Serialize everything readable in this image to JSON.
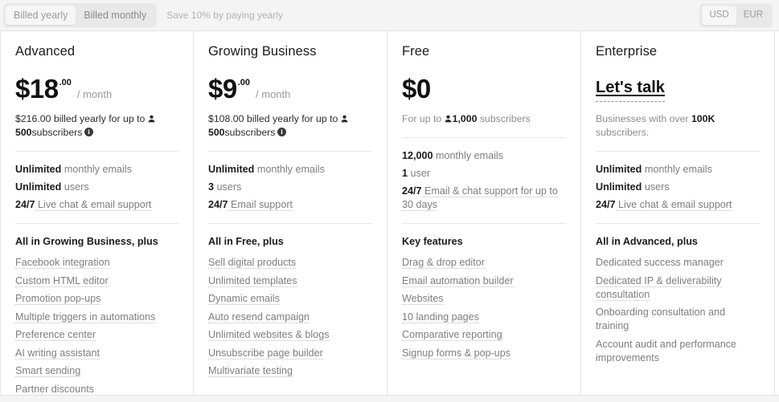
{
  "billing_toggle": {
    "options": [
      {
        "label": "Billed yearly",
        "active": true
      },
      {
        "label": "Billed monthly",
        "active": false
      }
    ],
    "save_note": "Save 10% by paying yearly"
  },
  "currency_toggle": {
    "options": [
      {
        "label": "USD",
        "active": true
      },
      {
        "label": "EUR",
        "active": false
      }
    ]
  },
  "icons": {
    "person": "person-icon",
    "info": "info-icon"
  },
  "plans": [
    {
      "name": "Advanced",
      "price_amount": "$18",
      "price_cents": ".00",
      "price_period": "/ month",
      "billing_note_prefix": "$216.00 billed yearly for up to ",
      "billing_note_count": "500",
      "billing_note_suffix": "subscribers",
      "has_info_icon": true,
      "specs": [
        {
          "bold": "Unlimited",
          "rest": " monthly emails",
          "dotted": false
        },
        {
          "bold": "Unlimited",
          "rest": " users",
          "dotted": false
        },
        {
          "bold": "24/7",
          "rest": " Live chat & email support",
          "dotted": true
        }
      ],
      "group_title": "All in Growing Business, plus",
      "features": [
        {
          "label": "Facebook integration",
          "dotted": true
        },
        {
          "label": "Custom HTML editor",
          "dotted": true
        },
        {
          "label": "Promotion pop-ups",
          "dotted": true
        },
        {
          "label": "Multiple triggers in automations",
          "dotted": true
        },
        {
          "label": "Preference center",
          "dotted": true
        },
        {
          "label": "AI writing assistant",
          "dotted": true
        },
        {
          "label": "Smart sending",
          "dotted": true
        },
        {
          "label": "Partner discounts",
          "dotted": true
        }
      ]
    },
    {
      "name": "Growing Business",
      "price_amount": "$9",
      "price_cents": ".00",
      "price_period": "/ month",
      "billing_note_prefix": "$108.00 billed yearly for up to ",
      "billing_note_count": "500",
      "billing_note_suffix": "subscribers",
      "has_info_icon": true,
      "specs": [
        {
          "bold": "Unlimited",
          "rest": " monthly emails",
          "dotted": false
        },
        {
          "bold": "3",
          "rest": " users",
          "dotted": false
        },
        {
          "bold": "24/7",
          "rest": " Email support",
          "dotted": true
        }
      ],
      "group_title": "All in Free, plus",
      "features": [
        {
          "label": "Sell digital products",
          "dotted": true
        },
        {
          "label": "Unlimited templates",
          "dotted": true
        },
        {
          "label": "Dynamic emails",
          "dotted": true
        },
        {
          "label": "Auto resend campaign",
          "dotted": true
        },
        {
          "label": "Unlimited websites & blogs",
          "dotted": true
        },
        {
          "label": "Unsubscribe page builder",
          "dotted": true
        },
        {
          "label": "Multivariate testing",
          "dotted": true
        }
      ]
    },
    {
      "name": "Free",
      "price_amount": "$0",
      "price_cents": "",
      "price_period": "",
      "billing_note_prefix": "For up to ",
      "billing_note_count": "1,000",
      "billing_note_suffix": " subscribers",
      "has_info_icon": false,
      "specs": [
        {
          "bold": "12,000",
          "rest": " monthly emails",
          "dotted": false
        },
        {
          "bold": "1",
          "rest": " user",
          "dotted": false
        },
        {
          "bold": "24/7",
          "rest": " Email & chat support for up to 30 days",
          "dotted": true
        }
      ],
      "group_title": "Key features",
      "features": [
        {
          "label": "Drag & drop editor",
          "dotted": true
        },
        {
          "label": "Email automation builder",
          "dotted": true
        },
        {
          "label": "Websites",
          "dotted": true
        },
        {
          "label": "10 landing pages",
          "dotted": true
        },
        {
          "label": "Comparative reporting",
          "dotted": true
        },
        {
          "label": "Signup forms & pop-ups",
          "dotted": true
        }
      ]
    },
    {
      "name": "Enterprise",
      "price_amount": "Let's talk",
      "price_cents": "",
      "price_period": "",
      "billing_note_prefix": "Businesses with over ",
      "billing_note_count": "100K",
      "billing_note_suffix": " subscribers.",
      "has_info_icon": false,
      "specs": [
        {
          "bold": "Unlimited",
          "rest": " monthly emails",
          "dotted": false
        },
        {
          "bold": "Unlimited",
          "rest": " users",
          "dotted": false
        },
        {
          "bold": "24/7",
          "rest": " Live chat & email support",
          "dotted": true
        }
      ],
      "group_title": "All in Advanced, plus",
      "features": [
        {
          "label": "Dedicated success manager",
          "dotted": false
        },
        {
          "label": "Dedicated IP & deliverability consultation",
          "dotted": true
        },
        {
          "label": "Onboarding consultation and training",
          "dotted": false
        },
        {
          "label": "Account audit and performance improvements",
          "dotted": false
        }
      ]
    }
  ]
}
